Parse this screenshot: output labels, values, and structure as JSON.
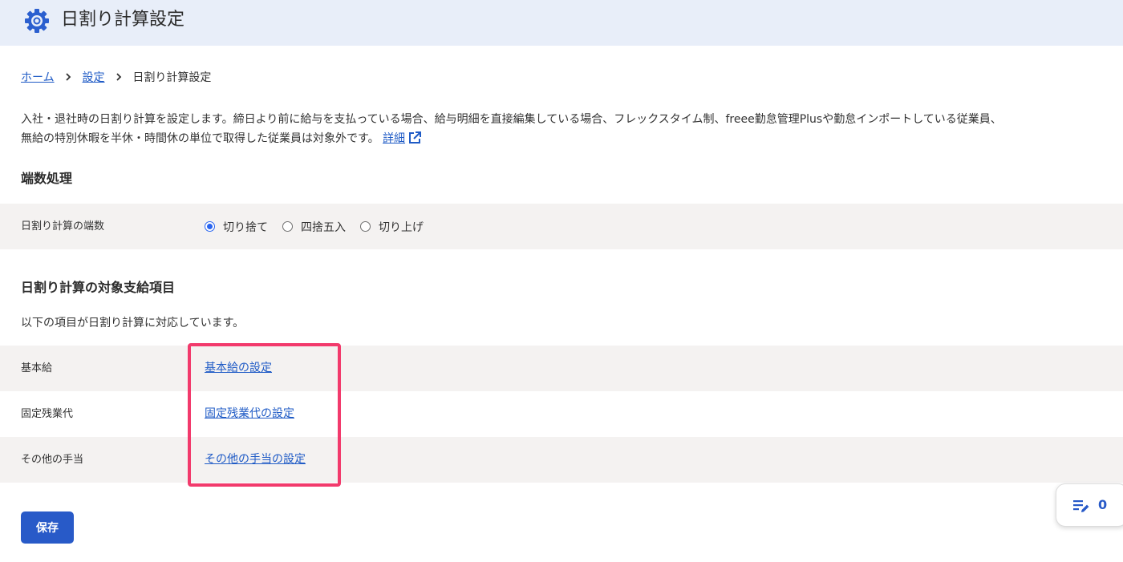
{
  "header": {
    "title": "日割り計算設定",
    "icon": "gear-icon",
    "accent": "#2b5fcf"
  },
  "breadcrumb": {
    "home": "ホーム",
    "settings": "設定",
    "current": "日割り計算設定"
  },
  "description": {
    "line1": "入社・退社時の日割り計算を設定します。締日より前に給与を支払っている場合、給与明細を直接編集している場合、フレックスタイム制、freee勤怠管理Plusや勤怠インポートしている従業員、",
    "line2": "無給の特別休暇を半休・時間休の単位で取得した従業員は対象外です。",
    "detail_link": "詳細"
  },
  "rounding": {
    "section_title": "端数処理",
    "row_label": "日割り計算の端数",
    "options": [
      {
        "label": "切り捨て",
        "checked": true
      },
      {
        "label": "四捨五入",
        "checked": false
      },
      {
        "label": "切り上げ",
        "checked": false
      }
    ]
  },
  "targets": {
    "section_title": "日割り計算の対象支給項目",
    "description": "以下の項目が日割り計算に対応しています。",
    "rows": [
      {
        "label": "基本給",
        "link": "基本給の設定"
      },
      {
        "label": "固定残業代",
        "link": "固定残業代の設定"
      },
      {
        "label": "その他の手当",
        "link": "その他の手当の設定"
      }
    ]
  },
  "save_button": "保存",
  "float_panel": {
    "icon": "edit-list-icon",
    "count": "0"
  },
  "colors": {
    "header_bg": "#e8eef9",
    "link": "#1f5bc6",
    "primary": "#285ac8",
    "highlight": "#f23a6c",
    "row_gray": "#f4f2f1"
  }
}
